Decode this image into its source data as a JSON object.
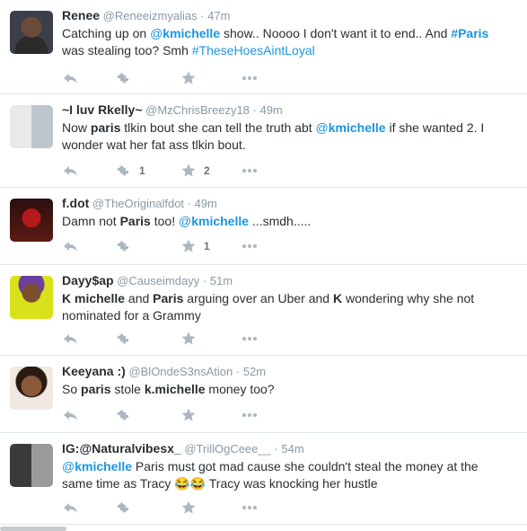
{
  "tweets": [
    {
      "name": "Renee",
      "handle": "@Reneeizmyalias",
      "time": "47m",
      "text": [
        {
          "t": "Catching up on "
        },
        {
          "t": "@",
          "k": "mention-at"
        },
        {
          "t": "kmichelle",
          "k": "mention-name"
        },
        {
          "t": " show.. Noooo I don't want it to end.. And "
        },
        {
          "t": "#Paris",
          "k": "hashtag-bold"
        },
        {
          "t": " was stealing too? Smh "
        },
        {
          "t": "#TheseHoesAintLoyal",
          "k": "hashtag"
        }
      ],
      "retweets": "",
      "favorites": ""
    },
    {
      "name": "~I luv Rkelly~",
      "handle": "@MzChrisBreezy18",
      "time": "49m",
      "text": [
        {
          "t": "Now "
        },
        {
          "t": "paris",
          "k": "b"
        },
        {
          "t": " tlkin bout she can tell the truth abt "
        },
        {
          "t": "@",
          "k": "mention-at"
        },
        {
          "t": "kmichelle",
          "k": "mention-name"
        },
        {
          "t": " if she wanted 2. I wonder wat her fat ass tlkin bout."
        }
      ],
      "retweets": "1",
      "favorites": "2"
    },
    {
      "name": "f.dot",
      "handle": "@TheOriginalfdot",
      "time": "49m",
      "text": [
        {
          "t": "Damn not "
        },
        {
          "t": "Paris",
          "k": "b"
        },
        {
          "t": " too! "
        },
        {
          "t": "@",
          "k": "mention-at"
        },
        {
          "t": "kmichelle",
          "k": "mention-name"
        },
        {
          "t": " ...smdh....."
        }
      ],
      "retweets": "",
      "favorites": "1"
    },
    {
      "name": "Dayy$ap",
      "handle": "@Causeimdayy",
      "time": "51m",
      "text": [
        {
          "t": "K michelle",
          "k": "b"
        },
        {
          "t": " and "
        },
        {
          "t": "Paris",
          "k": "b"
        },
        {
          "t": " arguing over an Uber and "
        },
        {
          "t": "K",
          "k": "b"
        },
        {
          "t": " wondering why she not nominated for a Grammy"
        }
      ],
      "retweets": "",
      "favorites": ""
    },
    {
      "name": "Keeyana :)",
      "handle": "@BlOndeS3nsAtion",
      "time": "52m",
      "text": [
        {
          "t": "So "
        },
        {
          "t": "paris",
          "k": "b"
        },
        {
          "t": " stole "
        },
        {
          "t": "k.michelle",
          "k": "b"
        },
        {
          "t": " money too?"
        }
      ],
      "retweets": "",
      "favorites": ""
    },
    {
      "name": "IG:@Naturalvibesx_",
      "handle": "@TrillOgCeee__",
      "time": "54m",
      "text": [
        {
          "t": "@",
          "k": "mention-at"
        },
        {
          "t": "kmichelle",
          "k": "mention-name"
        },
        {
          "t": " Paris must got mad cause she couldn't steal the money at the same time as Tracy "
        },
        {
          "t": "😂😂",
          "k": "emoji"
        },
        {
          "t": " Tracy was knocking her hustle"
        }
      ],
      "retweets": "",
      "favorites": ""
    }
  ],
  "icons": {
    "reply": "reply-icon",
    "retweet": "retweet-icon",
    "favorite": "star-icon",
    "more": "more-icon"
  },
  "colors": {
    "link": "#1b95e0",
    "muted": "#8899a6",
    "action_icon": "#aab8c2",
    "divider": "#e1e8ed"
  }
}
